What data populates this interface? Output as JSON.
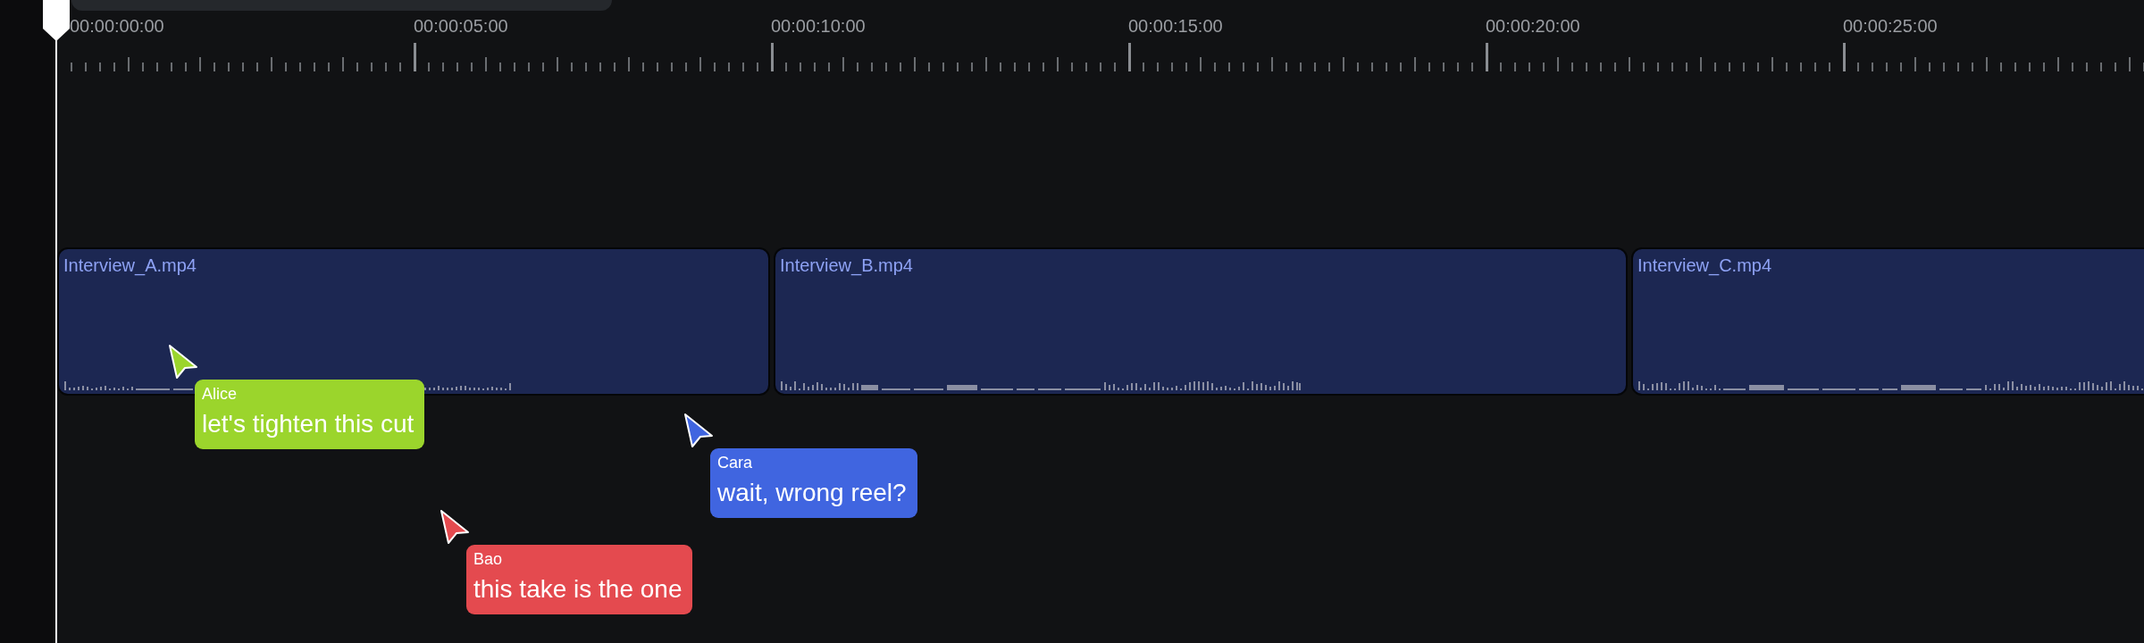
{
  "ruler": {
    "labels": [
      "00:00:00:00",
      "00:00:05:00",
      "00:00:10:00",
      "00:00:15:00",
      "00:00:20:00",
      "00:00:25:00"
    ]
  },
  "clips": [
    {
      "name": "Interview_A.mp4"
    },
    {
      "name": "Interview_B.mp4"
    },
    {
      "name": "Interview_C.mp4"
    }
  ],
  "collaborators": [
    {
      "name": "Alice",
      "message": "let's tighten this cut",
      "color": "#9bd52c"
    },
    {
      "name": "Cara",
      "message": "wait, wrong reel?",
      "color": "#4065e0"
    },
    {
      "name": "Bao",
      "message": "this take is the one",
      "color": "#e44a4f"
    }
  ]
}
